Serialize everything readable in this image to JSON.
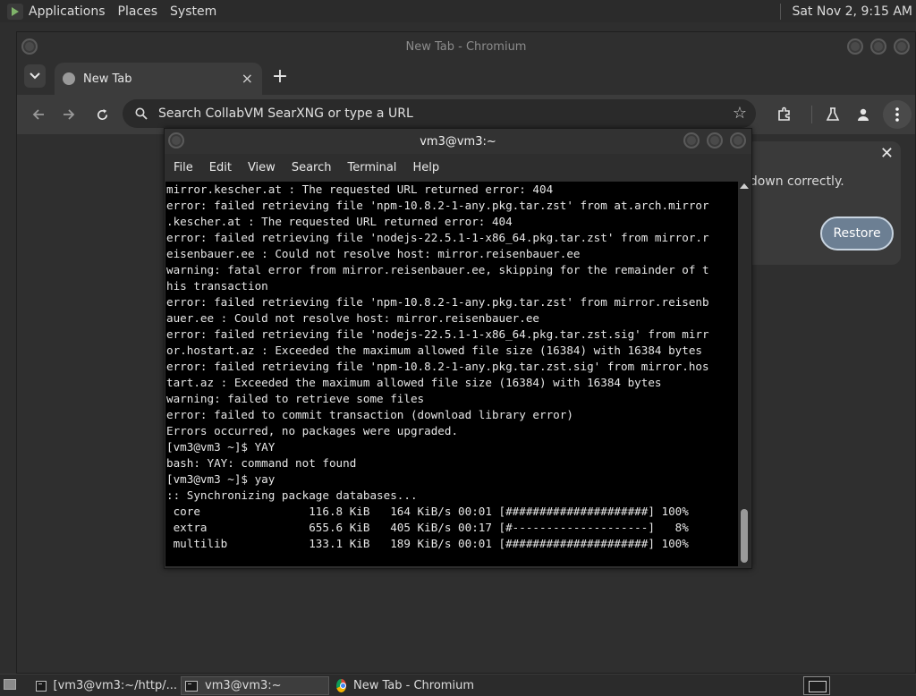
{
  "top_panel": {
    "menus": [
      "Applications",
      "Places",
      "System"
    ],
    "clock": "Sat Nov 2,  9:15 AM"
  },
  "chromium": {
    "title": "New Tab - Chromium",
    "tab_title": "New Tab",
    "tab_close": "×",
    "new_tab_symbol": "+",
    "omnibox_placeholder": "Search CollabVM SearXNG or type a URL",
    "restore_message": "ut down correctly.",
    "restore_button": "Restore",
    "restore_close": "✕"
  },
  "terminal": {
    "title": "vm3@vm3:~",
    "menus": [
      "File",
      "Edit",
      "View",
      "Search",
      "Terminal",
      "Help"
    ],
    "lines": [
      "mirror.kescher.at : The requested URL returned error: 404",
      "error: failed retrieving file 'npm-10.8.2-1-any.pkg.tar.zst' from at.arch.mirror",
      ".kescher.at : The requested URL returned error: 404",
      "error: failed retrieving file 'nodejs-22.5.1-1-x86_64.pkg.tar.zst' from mirror.r",
      "eisenbauer.ee : Could not resolve host: mirror.reisenbauer.ee",
      "warning: fatal error from mirror.reisenbauer.ee, skipping for the remainder of t",
      "his transaction",
      "error: failed retrieving file 'npm-10.8.2-1-any.pkg.tar.zst' from mirror.reisenb",
      "auer.ee : Could not resolve host: mirror.reisenbauer.ee",
      "error: failed retrieving file 'nodejs-22.5.1-1-x86_64.pkg.tar.zst.sig' from mirr",
      "or.hostart.az : Exceeded the maximum allowed file size (16384) with 16384 bytes",
      "error: failed retrieving file 'npm-10.8.2-1-any.pkg.tar.zst.sig' from mirror.hos",
      "tart.az : Exceeded the maximum allowed file size (16384) with 16384 bytes",
      "warning: failed to retrieve some files",
      "error: failed to commit transaction (download library error)",
      "Errors occurred, no packages were upgraded.",
      "[vm3@vm3 ~]$ YAY",
      "bash: YAY: command not found",
      "[vm3@vm3 ~]$ yay",
      ":: Synchronizing package databases...",
      " core                116.8 KiB   164 KiB/s 00:01 [#####################] 100%",
      " extra               655.6 KiB   405 KiB/s 00:17 [#--------------------]   8%",
      " multilib            133.1 KiB   189 KiB/s 00:01 [#####################] 100%"
    ]
  },
  "taskbar": {
    "tasks": [
      {
        "label": "[vm3@vm3:~/http/...",
        "icon": "terminal-icon"
      },
      {
        "label": "vm3@vm3:~",
        "icon": "terminal-icon"
      },
      {
        "label": "New Tab - Chromium",
        "icon": "chromium-icon"
      }
    ]
  },
  "colors": {
    "accent_restore": "#6c7f93",
    "terminal_bg": "#000000",
    "panel_bg": "#2b2b2b"
  }
}
